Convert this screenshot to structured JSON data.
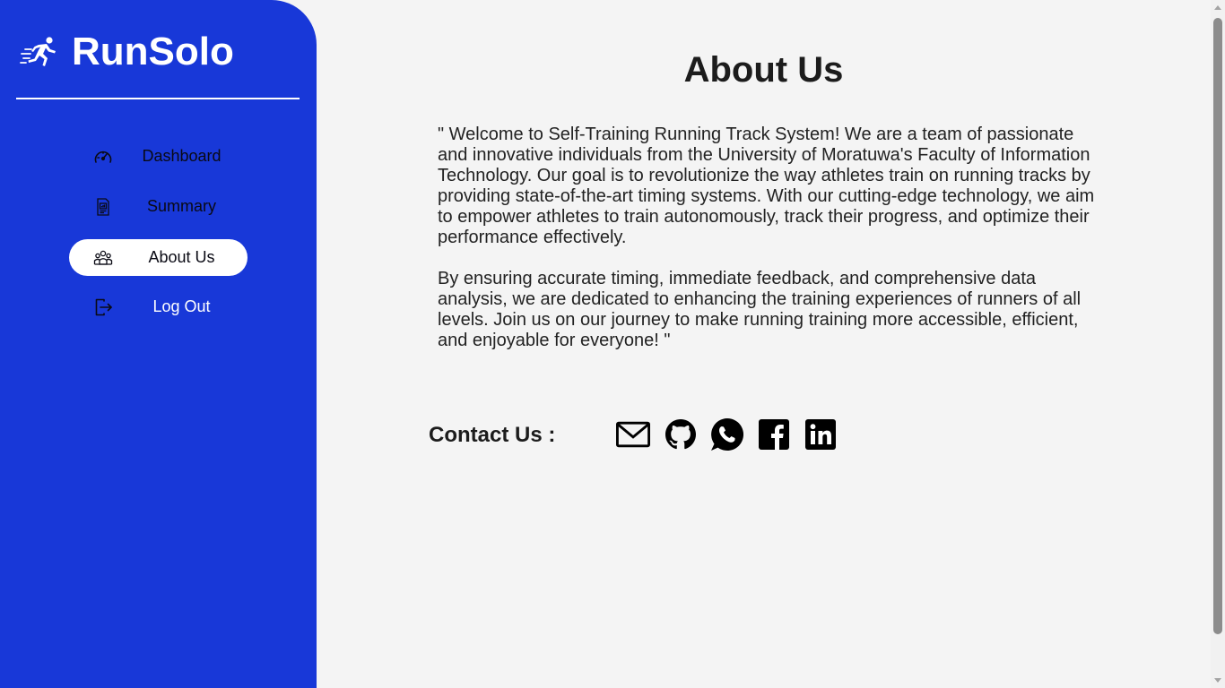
{
  "brand": {
    "title": "RunSolo",
    "icon": "runner-icon"
  },
  "sidebar": {
    "items": [
      {
        "label": "Dashboard",
        "icon": "speedometer-icon",
        "active": false
      },
      {
        "label": "Summary",
        "icon": "report-icon",
        "active": false
      },
      {
        "label": "About Us",
        "icon": "team-icon",
        "active": true
      },
      {
        "label": "Log Out",
        "icon": "logout-icon",
        "active": false
      }
    ]
  },
  "main": {
    "title": "About Us",
    "paragraphs": [
      "\" Welcome to Self-Training Running Track System! We are a team of passionate and innovative individuals from the University of Moratuwa's Faculty of Information Technology. Our goal is to revolutionize the way athletes train on running tracks by providing state-of-the-art timing systems. With our cutting-edge technology, we aim to empower athletes to train autonomously, track their progress, and optimize their performance effectively.",
      "By ensuring accurate timing, immediate feedback, and comprehensive data analysis, we are dedicated to enhancing the training experiences of runners of all levels. Join us on our journey to make running training more accessible, efficient, and enjoyable for everyone! \""
    ],
    "contact": {
      "label": "Contact Us :",
      "links": [
        "mail-icon",
        "github-icon",
        "whatsapp-icon",
        "facebook-icon",
        "linkedin-icon"
      ]
    }
  },
  "colors": {
    "sidebar_bg": "#1838d8",
    "page_bg": "#f4f4f4",
    "text": "#1c1c1c"
  }
}
